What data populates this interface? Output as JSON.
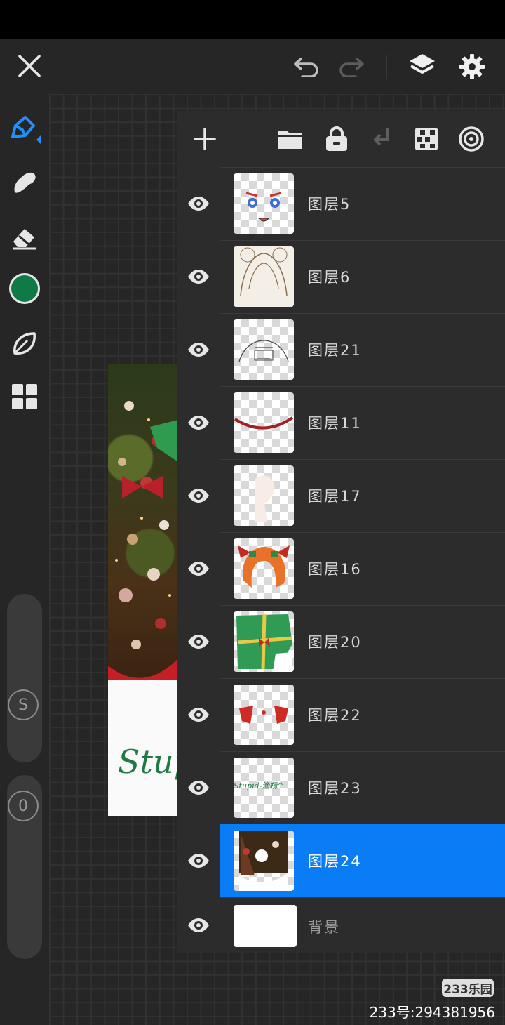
{
  "topbar": {
    "close_icon": "close-icon",
    "undo_icon": "undo-icon",
    "redo_icon": "redo-icon",
    "layers_icon": "layers-icon",
    "settings_icon": "gear-icon"
  },
  "toolbar": {
    "tools": [
      "pen-icon",
      "smudge-icon",
      "eraser-icon",
      "color-swatch",
      "leaf-icon",
      "grid-icon"
    ],
    "current_color": "#107a47",
    "size_slider_label": "S",
    "opacity_slider_label": "0"
  },
  "artwork": {
    "text": "Stupid-"
  },
  "layers_panel": {
    "toolbar": [
      "add-layer-icon",
      "folder-icon",
      "lock-icon",
      "merge-down-icon",
      "checker-icon",
      "target-icon"
    ],
    "layers": [
      {
        "name": "图层5",
        "selected": false
      },
      {
        "name": "图层6",
        "selected": false
      },
      {
        "name": "图层21",
        "selected": false
      },
      {
        "name": "图层11",
        "selected": false
      },
      {
        "name": "图层17",
        "selected": false
      },
      {
        "name": "图层16",
        "selected": false
      },
      {
        "name": "图层20",
        "selected": false
      },
      {
        "name": "图层22",
        "selected": false
      },
      {
        "name": "图层23",
        "selected": false,
        "thumb_text": "Stupid-渔棈^"
      },
      {
        "name": "图层24",
        "selected": true
      },
      {
        "name": "背景",
        "selected": false
      }
    ],
    "selection_color": "#0a7cf5"
  },
  "watermark": {
    "logo": "233乐园",
    "id": "233号:294381956"
  }
}
